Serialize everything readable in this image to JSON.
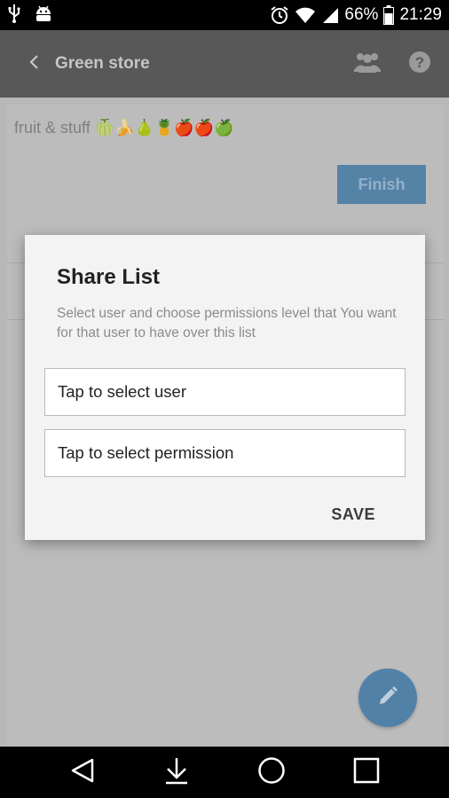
{
  "status_bar": {
    "battery": "66%",
    "time": "21:29",
    "icons": [
      "usb-icon",
      "android-debug-icon",
      "alarm-icon",
      "wifi-icon",
      "signal-icon",
      "battery-icon"
    ]
  },
  "toolbar": {
    "title": "Green store",
    "icons": [
      "back-chevron-icon",
      "people-icon",
      "help-icon"
    ]
  },
  "list": {
    "name": "fruit & stuff 🍈🍌🍐🍍🍎🍎🍏",
    "finish_label": "Finish"
  },
  "dialog": {
    "title": "Share List",
    "message": "Select user and choose permissions level that You want for that user to have over this list",
    "user_field": "Tap to select user",
    "permission_field": "Tap to select permission",
    "save_label": "SAVE"
  },
  "nav_bar": {
    "icons": [
      "back-triangle-icon",
      "download-arrow-icon",
      "home-circle-icon",
      "recents-square-icon"
    ]
  },
  "colors": {
    "toolbar": "#606060",
    "accent": "#5a8cb7",
    "dialog_bg": "#f3f3f3"
  }
}
